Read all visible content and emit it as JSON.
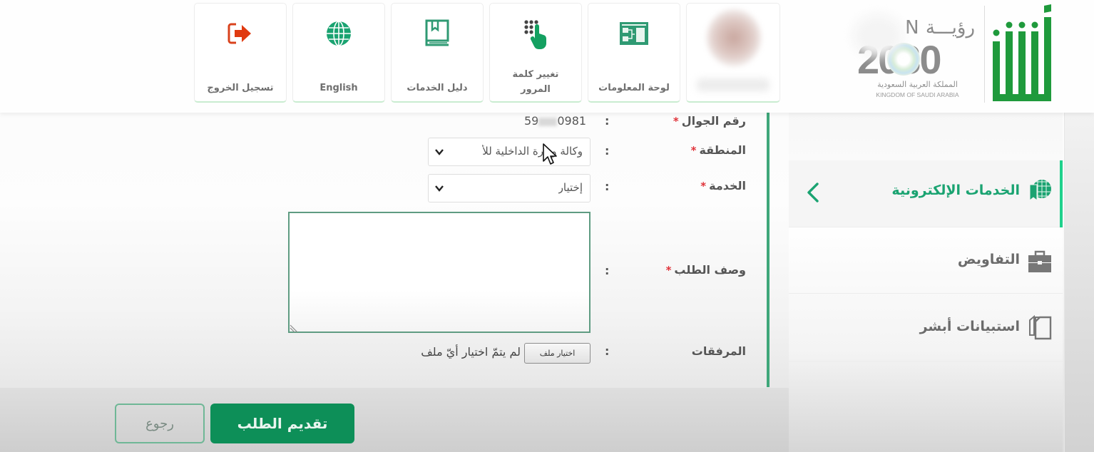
{
  "header": {
    "tiles": [
      {
        "id": "logout",
        "label": "تسجيل الخروج",
        "icon": "logout-icon"
      },
      {
        "id": "english",
        "label": "English",
        "icon": "globe-icon"
      },
      {
        "id": "services_guide",
        "label": "دليل الخدمات",
        "icon": "book-icon"
      },
      {
        "id": "change_password",
        "label": "تغيير كلمة المرور",
        "label_line1": "تغيير كلمة",
        "label_line2": "المرور",
        "icon": "keypad-hand-icon"
      },
      {
        "id": "dashboard",
        "label": "لوحة المعلومات",
        "icon": "dashboard-icon"
      },
      {
        "id": "profile",
        "label": "",
        "icon": "avatar"
      }
    ],
    "vision_logo": {
      "arabic_title": "رؤيـــة",
      "latin_title": "VISION",
      "year": "2030",
      "arabic_country": "المملكة العربية السعودية",
      "english_country": "KINGDOM OF SAUDI ARABIA"
    },
    "brand": "أبشر"
  },
  "form": {
    "mobile": {
      "label": "رقم الجوال",
      "required": true,
      "value_prefix": "59",
      "value_suffix": "0981"
    },
    "region": {
      "label": "المنطقة",
      "required": true,
      "selected": "وكالة وزارة الداخلية للأ"
    },
    "service": {
      "label": "الخدمة",
      "required": true,
      "selected": "إختيار"
    },
    "description": {
      "label": "وصف الطلب",
      "required": true,
      "value": ""
    },
    "attachments": {
      "label": "المرفقات",
      "required": false,
      "button": "اختيار ملف",
      "status": "لم يتمّ اختيار أيّ ملف"
    },
    "colon": ":",
    "required_mark": "*"
  },
  "actions": {
    "submit": "تقديم الطلب",
    "back": "رجوع"
  },
  "sidebar": {
    "items": [
      {
        "label": "الخدمات الإلكترونية",
        "icon": "e-services-icon",
        "active": true
      },
      {
        "label": "التفاويض",
        "icon": "briefcase-icon",
        "active": false
      },
      {
        "label": "استبيانات أبشر",
        "icon": "documents-icon",
        "active": false
      }
    ]
  },
  "colors": {
    "brand_green": "#0d8f58",
    "accent_green": "#1fd18c",
    "divider_green": "#3fa77a",
    "required_red": "#e0333a",
    "logout_red": "#d9421c"
  }
}
